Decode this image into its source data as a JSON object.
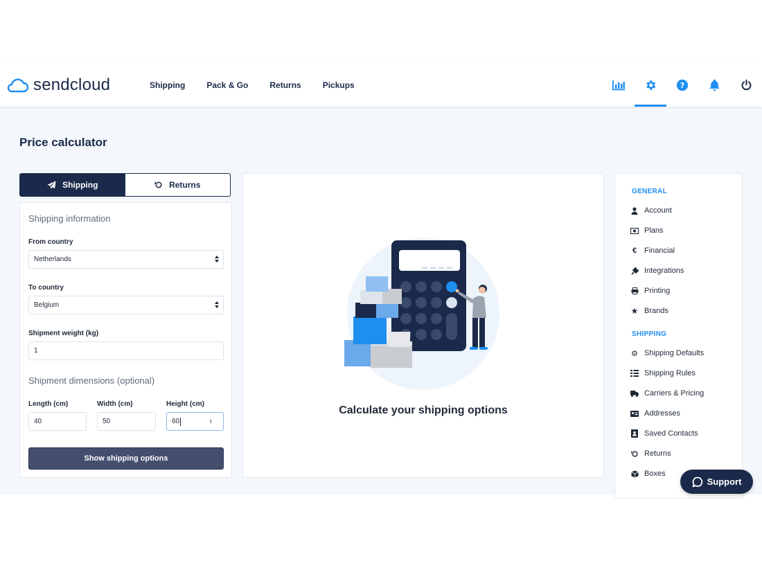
{
  "brand": {
    "name": "sendcloud",
    "color": "#1f8ef1",
    "navy": "#1b2a4a"
  },
  "nav": [
    "Shipping",
    "Pack & Go",
    "Returns",
    "Pickups"
  ],
  "header_icons": [
    "analytics-icon",
    "gear-icon",
    "help-icon",
    "bell-icon",
    "power-icon"
  ],
  "page": {
    "title": "Price calculator"
  },
  "tabs": {
    "shipping": "Shipping",
    "returns": "Returns",
    "active": "Shipping"
  },
  "form": {
    "section_info": "Shipping information",
    "from_label": "From country",
    "from_value": "Netherlands",
    "to_label": "To country",
    "to_value": "Belgium",
    "weight_label": "Shipment weight (kg)",
    "weight_value": "1",
    "dims_section": "Shipment dimensions (optional)",
    "length_label": "Length (cm)",
    "length_value": "40",
    "width_label": "Width (cm)",
    "width_value": "50",
    "height_label": "Height (cm)",
    "height_value": "60",
    "submit": "Show shipping options"
  },
  "center": {
    "message": "Calculate your shipping options"
  },
  "sidebar": {
    "general_heading": "GENERAL",
    "general": [
      {
        "label": "Account",
        "icon": "user-icon"
      },
      {
        "label": "Plans",
        "icon": "banknote-icon"
      },
      {
        "label": "Financial",
        "icon": "euro-icon"
      },
      {
        "label": "Integrations",
        "icon": "plug-icon"
      },
      {
        "label": "Printing",
        "icon": "printer-icon"
      },
      {
        "label": "Brands",
        "icon": "star-icon"
      }
    ],
    "shipping_heading": "SHIPPING",
    "shipping": [
      {
        "label": "Shipping Defaults",
        "icon": "gear-icon"
      },
      {
        "label": "Shipping Rules",
        "icon": "rules-icon"
      },
      {
        "label": "Carriers & Pricing",
        "icon": "truck-icon"
      },
      {
        "label": "Addresses",
        "icon": "address-card-icon"
      },
      {
        "label": "Saved Contacts",
        "icon": "contact-book-icon"
      },
      {
        "label": "Returns",
        "icon": "undo-icon"
      },
      {
        "label": "Boxes",
        "icon": "box-icon"
      }
    ]
  },
  "support": {
    "label": "Support"
  }
}
